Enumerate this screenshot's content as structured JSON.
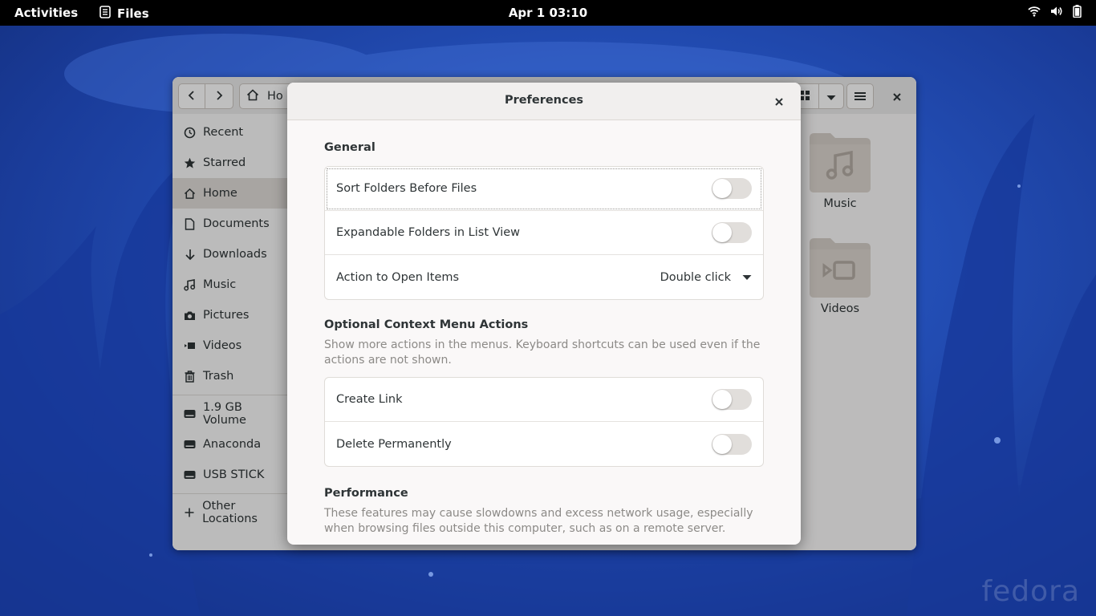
{
  "topbar": {
    "activities": "Activities",
    "app_name": "Files",
    "clock": "Apr 1  03:10"
  },
  "files_window": {
    "path_label": "Ho",
    "sidebar": [
      {
        "label": "Recent",
        "icon": "clock-icon"
      },
      {
        "label": "Starred",
        "icon": "star-icon"
      },
      {
        "label": "Home",
        "icon": "home-icon",
        "active": true
      },
      {
        "label": "Documents",
        "icon": "document-icon"
      },
      {
        "label": "Downloads",
        "icon": "download-icon"
      },
      {
        "label": "Music",
        "icon": "music-icon"
      },
      {
        "label": "Pictures",
        "icon": "camera-icon"
      },
      {
        "label": "Videos",
        "icon": "video-icon"
      },
      {
        "label": "Trash",
        "icon": "trash-icon"
      }
    ],
    "devices": [
      {
        "label": "1.9 GB Volume",
        "icon": "drive-icon"
      },
      {
        "label": "Anaconda",
        "icon": "drive-icon"
      },
      {
        "label": "USB STICK",
        "icon": "drive-icon"
      }
    ],
    "other_locations": "Other Locations",
    "folders": [
      {
        "label": "Music",
        "icon": "music-folder-icon"
      },
      {
        "label": "Videos",
        "icon": "video-folder-icon"
      }
    ]
  },
  "preferences": {
    "title": "Preferences",
    "general": {
      "title": "General",
      "sort_folders": {
        "label": "Sort Folders Before Files",
        "enabled": false
      },
      "expandable_folders": {
        "label": "Expandable Folders in List View",
        "enabled": false
      },
      "open_action": {
        "label": "Action to Open Items",
        "value": "Double click"
      }
    },
    "context_menu": {
      "title": "Optional Context Menu Actions",
      "description": "Show more actions in the menus. Keyboard shortcuts can be used even if the actions are not shown.",
      "create_link": {
        "label": "Create Link",
        "enabled": false
      },
      "delete_permanently": {
        "label": "Delete Permanently",
        "enabled": false
      }
    },
    "performance": {
      "title": "Performance",
      "description": "These features may cause slowdowns and excess network usage, especially when browsing files outside this computer, such as on a remote server."
    }
  },
  "colors": {
    "topbar_bg": "#000000",
    "dialog_bg": "#faf8f8",
    "switch_off": "#e1dedb",
    "folder_tint": "#d6cfc8"
  }
}
